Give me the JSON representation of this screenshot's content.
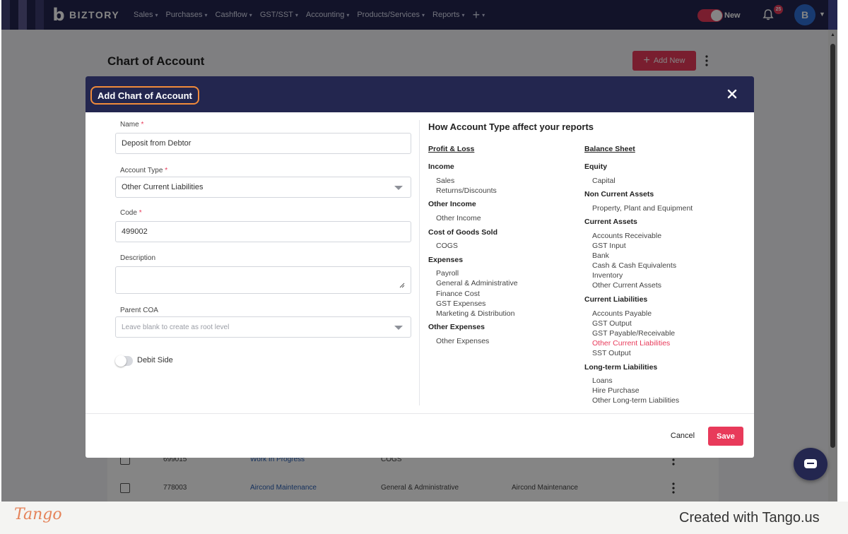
{
  "navbar": {
    "brand": "BIZTORY",
    "menu": [
      {
        "label": "Sales"
      },
      {
        "label": "Purchases"
      },
      {
        "label": "Cashflow"
      },
      {
        "label": "GST/SST"
      },
      {
        "label": "Accounting"
      },
      {
        "label": "Products/Services"
      },
      {
        "label": "Reports"
      }
    ],
    "plus_label": "+",
    "new_toggle_label": "New",
    "new_toggle_on": true,
    "notification_count": "25",
    "avatar_initial": "B",
    "accent_color": "#e83a5a",
    "bar_color": "#23264f"
  },
  "page": {
    "title": "Chart of Account",
    "add_new_label": "Add New",
    "rows": [
      {
        "code": "699015",
        "name": "Work In Progress",
        "type": "COGS",
        "description": ""
      },
      {
        "code": "778003",
        "name": "Aircond Maintenance",
        "type": "General & Administrative",
        "description": "Aircond Maintenance"
      }
    ]
  },
  "modal": {
    "title": "Add Chart of Account",
    "form": {
      "name_label": "Name",
      "name_value": "Deposit from Debtor",
      "account_type_label": "Account Type",
      "account_type_value": "Other Current Liabilities",
      "code_label": "Code",
      "code_value": "499002",
      "description_label": "Description",
      "description_value": "",
      "parent_label": "Parent COA",
      "parent_placeholder": "Leave blank to create as root level",
      "debit_side_label": "Debit Side",
      "debit_side_on": false,
      "required_mark": "*"
    },
    "info": {
      "title": "How Account Type affect your reports",
      "profit_loss": {
        "heading": "Profit & Loss",
        "groups": [
          {
            "name": "Income",
            "items": [
              "Sales",
              "Returns/Discounts"
            ]
          },
          {
            "name": "Other Income",
            "items": [
              "Other Income"
            ]
          },
          {
            "name": "Cost of Goods Sold",
            "items": [
              "COGS"
            ]
          },
          {
            "name": "Expenses",
            "items": [
              "Payroll",
              "General & Administrative",
              "Finance Cost",
              "GST Expenses",
              "Marketing & Distribution"
            ]
          },
          {
            "name": "Other Expenses",
            "items": [
              "Other Expenses"
            ]
          }
        ]
      },
      "balance_sheet": {
        "heading": "Balance Sheet",
        "groups": [
          {
            "name": "Equity",
            "items": [
              "Capital"
            ]
          },
          {
            "name": "Non Current Assets",
            "items": [
              "Property, Plant and Equipment"
            ]
          },
          {
            "name": "Current Assets",
            "items": [
              "Accounts Receivable",
              "GST Input",
              "Bank",
              "Cash & Cash Equivalents",
              "Inventory",
              "Other Current Assets"
            ]
          },
          {
            "name": "Current Liabilities",
            "items": [
              "Accounts Payable",
              "GST Output",
              "GST Payable/Receivable",
              "Other Current Liabilities",
              "SST Output"
            ]
          },
          {
            "name": "Long-term Liabilities",
            "items": [
              "Loans",
              "Hire Purchase",
              "Other Long-term Liabilities"
            ]
          }
        ]
      },
      "highlighted_item": "Other Current Liabilities"
    },
    "cancel_label": "Cancel",
    "save_label": "Save"
  },
  "tango": {
    "logo": "Tango",
    "created_with": "Created with Tango.us"
  }
}
